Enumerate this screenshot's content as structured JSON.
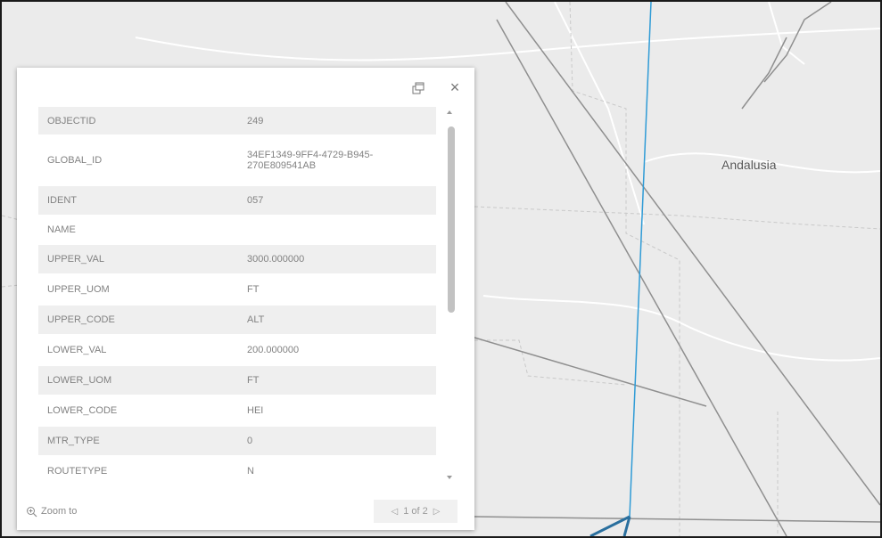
{
  "map": {
    "place_label": "Andalusia"
  },
  "popup": {
    "attributes": [
      {
        "key": "OBJECTID",
        "value": "249"
      },
      {
        "key": "GLOBAL_ID",
        "value": "34EF1349-9FF4-4729-B945-270E809541AB"
      },
      {
        "key": "IDENT",
        "value": "057"
      },
      {
        "key": "NAME",
        "value": ""
      },
      {
        "key": "UPPER_VAL",
        "value": "3000.000000"
      },
      {
        "key": "UPPER_UOM",
        "value": "FT"
      },
      {
        "key": "UPPER_CODE",
        "value": "ALT"
      },
      {
        "key": "LOWER_VAL",
        "value": "200.000000"
      },
      {
        "key": "LOWER_UOM",
        "value": "FT"
      },
      {
        "key": "LOWER_CODE",
        "value": "HEI"
      },
      {
        "key": "MTR_TYPE",
        "value": "0"
      },
      {
        "key": "ROUTETYPE",
        "value": "N"
      }
    ],
    "footer": {
      "zoom_to_label": "Zoom to",
      "pager_label": "1 of 2"
    }
  },
  "colors": {
    "route_line": "#2f9bd6",
    "map_background": "#ebebeb",
    "road": "#8f8f8f"
  }
}
